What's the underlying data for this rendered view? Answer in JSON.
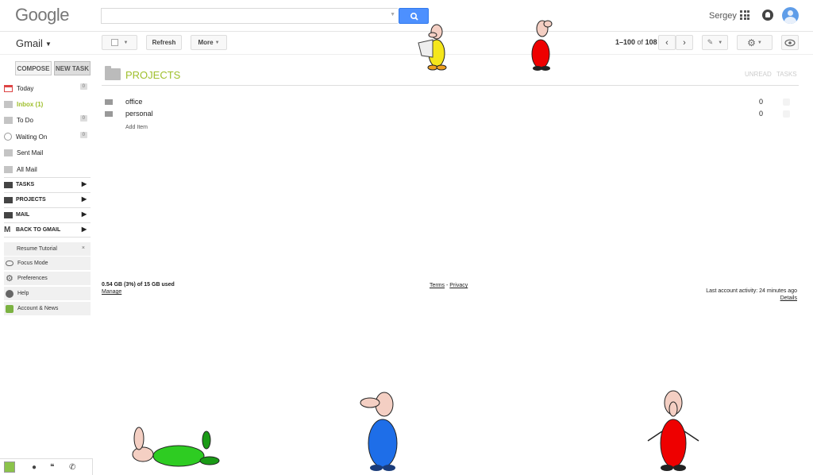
{
  "header": {
    "logo": "Google",
    "search_placeholder": "",
    "user_name": "Sergey"
  },
  "toolbar": {
    "app_label": "Gmail",
    "refresh_label": "Refresh",
    "more_label": "More",
    "page_range": "1–100",
    "page_of": "of",
    "page_total": "108"
  },
  "sidebar": {
    "compose_label": "COMPOSE",
    "new_task_label": "NEW TASK",
    "items": [
      {
        "label": "Today",
        "count": "0",
        "icon": "calendar-icon"
      },
      {
        "label": "Inbox (1)",
        "count": "",
        "icon": "mail-icon",
        "active": true
      },
      {
        "label": "To Do",
        "count": "0",
        "icon": "mail-icon"
      },
      {
        "label": "Waiting On",
        "count": "0",
        "icon": "clock-icon"
      },
      {
        "label": "Sent Mail",
        "count": "",
        "icon": "mail-icon"
      },
      {
        "label": "All Mail",
        "count": "",
        "icon": "mail-icon"
      }
    ],
    "sections": [
      {
        "label": "TASKS"
      },
      {
        "label": "PROJECTS"
      },
      {
        "label": "MAIL"
      },
      {
        "label": "BACK TO GMAIL"
      }
    ],
    "tools": [
      {
        "label": "Resume Tutorial",
        "close": "×"
      },
      {
        "label": "Focus Mode"
      },
      {
        "label": "Preferences"
      },
      {
        "label": "Help"
      },
      {
        "label": "Account & News"
      }
    ]
  },
  "main": {
    "title": "PROJECTS",
    "col_unread": "UNREAD",
    "col_tasks": "TASKS",
    "rows": [
      {
        "name": "office",
        "unread": "0"
      },
      {
        "name": "personal",
        "unread": "0"
      }
    ],
    "add_item": "Add Item"
  },
  "footer": {
    "storage": "0.54 GB (3%) of 15 GB used",
    "manage": "Manage",
    "terms": "Terms",
    "sep": " - ",
    "privacy": "Privacy",
    "activity": "Last account activity: 24 minutes ago",
    "details": "Details"
  },
  "colors": {
    "accent_green": "#9fbf2c",
    "search_blue": "#4d90fe"
  }
}
